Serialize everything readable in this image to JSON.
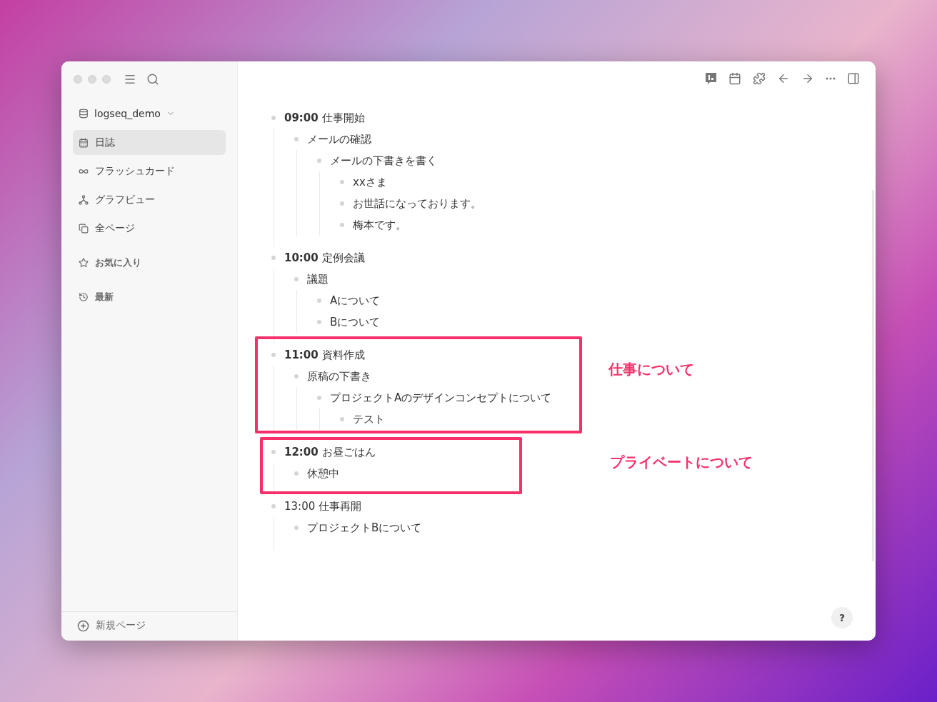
{
  "sidebar": {
    "graph": "logseq_demo",
    "items": [
      {
        "label": "日誌",
        "selected": true
      },
      {
        "label": "フラッシュカード",
        "selected": false
      },
      {
        "label": "グラフビュー",
        "selected": false
      },
      {
        "label": "全ページ",
        "selected": false
      }
    ],
    "sections": [
      {
        "label": "お気に入り"
      },
      {
        "label": "最新"
      }
    ],
    "new_page": "新規ページ"
  },
  "outline": [
    {
      "time": "09:00",
      "text": "仕事開始",
      "children": [
        {
          "text": "メールの確認",
          "children": [
            {
              "text": "メールの下書きを書く",
              "children": [
                {
                  "text": "xxさま"
                },
                {
                  "text": "お世話になっております。"
                },
                {
                  "text": "梅本です。"
                }
              ]
            }
          ]
        }
      ]
    },
    {
      "time": "10:00",
      "text": "定例会議",
      "children": [
        {
          "text": "議題",
          "children": [
            {
              "text": "Aについて"
            },
            {
              "text": "Bについて"
            }
          ]
        }
      ]
    },
    {
      "time": "11:00",
      "text": "資料作成",
      "children": [
        {
          "text": "原稿の下書き",
          "children": [
            {
              "text": "プロジェクトAのデザインコンセプトについて",
              "children": [
                {
                  "text": "テスト"
                }
              ]
            }
          ]
        }
      ]
    },
    {
      "time": "12:00",
      "text": "お昼ごはん",
      "children": [
        {
          "text": "休憩中"
        }
      ]
    },
    {
      "text": "13:00 仕事再開",
      "children": [
        {
          "text": "プロジェクトBについて"
        }
      ]
    }
  ],
  "annotations": [
    {
      "label": "仕事について",
      "color": "#f7306b"
    },
    {
      "label": "プライベートについて",
      "color": "#f7306b"
    }
  ],
  "help": "?"
}
